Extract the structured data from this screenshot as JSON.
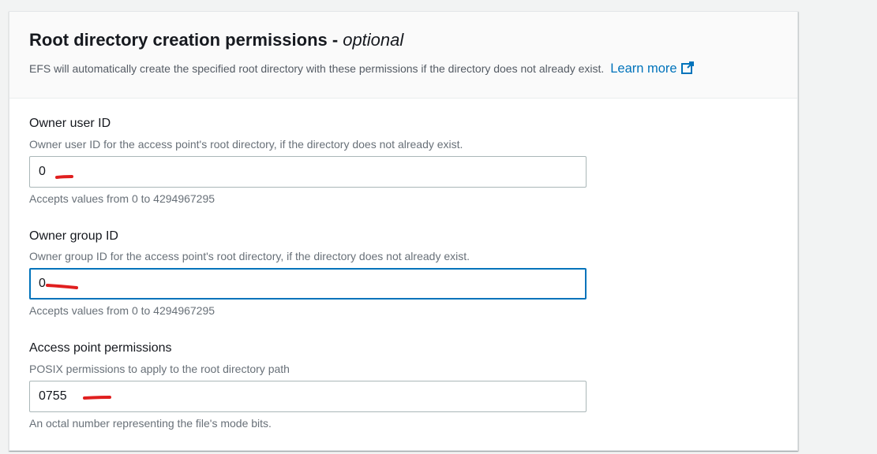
{
  "section": {
    "title": "Root directory creation permissions -",
    "title_optional": "optional",
    "description": "EFS will automatically create the specified root directory with these permissions if the directory does not already exist.",
    "learn_more": "Learn more",
    "icon": "external-link-icon"
  },
  "fields": [
    {
      "label": "Owner user ID",
      "description": "Owner user ID for the access point's root directory, if the directory does not already exist.",
      "value": "0",
      "constraint": "Accepts values from 0 to 4294967295"
    },
    {
      "label": "Owner group ID",
      "description": "Owner group ID for the access point's root directory, if the directory does not already exist.",
      "value": "0",
      "constraint": "Accepts values from 0 to 4294967295",
      "focused": true
    },
    {
      "label": "Access point permissions",
      "description": "POSIX permissions to apply to the root directory path",
      "value": "0755",
      "constraint": "An octal number representing the file's mode bits."
    }
  ],
  "colors": {
    "link": "#0073bb",
    "focus_border": "#0073bb",
    "annotation": "#e01f1f"
  }
}
